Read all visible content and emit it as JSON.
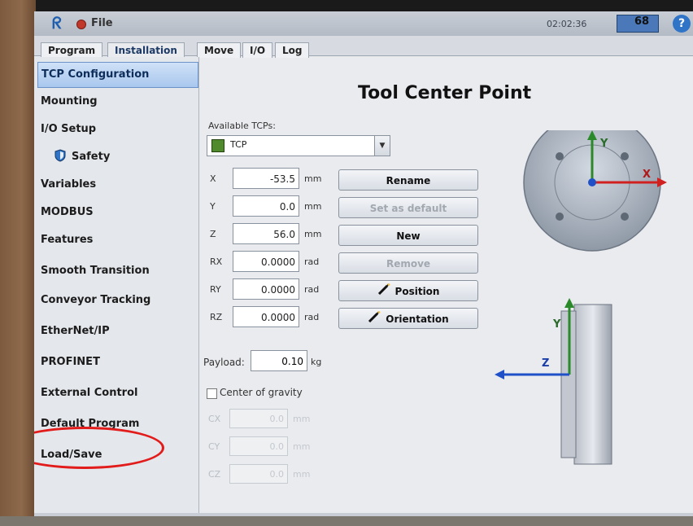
{
  "titlebar": {
    "file_menu": "File",
    "clock": "02:02:36",
    "speed": "68",
    "help": "?"
  },
  "tabs": [
    {
      "label": "Program"
    },
    {
      "label": "Installation"
    },
    {
      "label": "Move"
    },
    {
      "label": "I/O"
    },
    {
      "label": "Log"
    }
  ],
  "sidebar": {
    "items": [
      {
        "label": "TCP Configuration"
      },
      {
        "label": "Mounting"
      },
      {
        "label": "I/O Setup"
      },
      {
        "label": "Safety"
      },
      {
        "label": "Variables"
      },
      {
        "label": "MODBUS"
      },
      {
        "label": "Features"
      },
      {
        "label": "Smooth Transition"
      },
      {
        "label": "Conveyor Tracking"
      },
      {
        "label": "EtherNet/IP"
      },
      {
        "label": "PROFINET"
      },
      {
        "label": "External Control"
      },
      {
        "label": "Default Program"
      },
      {
        "label": "Load/Save"
      }
    ]
  },
  "main": {
    "title": "Tool Center Point",
    "available_label": "Available TCPs:",
    "selected_tcp": "TCP",
    "coords": [
      {
        "name": "X",
        "value": "-53.5",
        "unit": "mm"
      },
      {
        "name": "Y",
        "value": "0.0",
        "unit": "mm"
      },
      {
        "name": "Z",
        "value": "56.0",
        "unit": "mm"
      },
      {
        "name": "RX",
        "value": "0.0000",
        "unit": "rad"
      },
      {
        "name": "RY",
        "value": "0.0000",
        "unit": "rad"
      },
      {
        "name": "RZ",
        "value": "0.0000",
        "unit": "rad"
      }
    ],
    "buttons": {
      "rename": "Rename",
      "set_default": "Set as default",
      "new": "New",
      "remove": "Remove",
      "position": "Position",
      "orientation": "Orientation"
    },
    "payload_label": "Payload:",
    "payload_value": "0.10",
    "payload_unit": "kg",
    "cog_label": "Center of gravity",
    "cog_rows": [
      {
        "name": "CX",
        "value": "0.0",
        "unit": "mm"
      },
      {
        "name": "CY",
        "value": "0.0",
        "unit": "mm"
      },
      {
        "name": "CZ",
        "value": "0.0",
        "unit": "mm"
      }
    ]
  },
  "diagram": {
    "top_y": "Y",
    "top_x": "X",
    "side_y": "Y",
    "side_z": "Z"
  },
  "colors": {
    "accent_blue": "#2f74c6",
    "axis_x": "#d02020",
    "axis_y": "#2a8a2a",
    "axis_z": "#2050c8",
    "annotation": "#e21b1b"
  }
}
